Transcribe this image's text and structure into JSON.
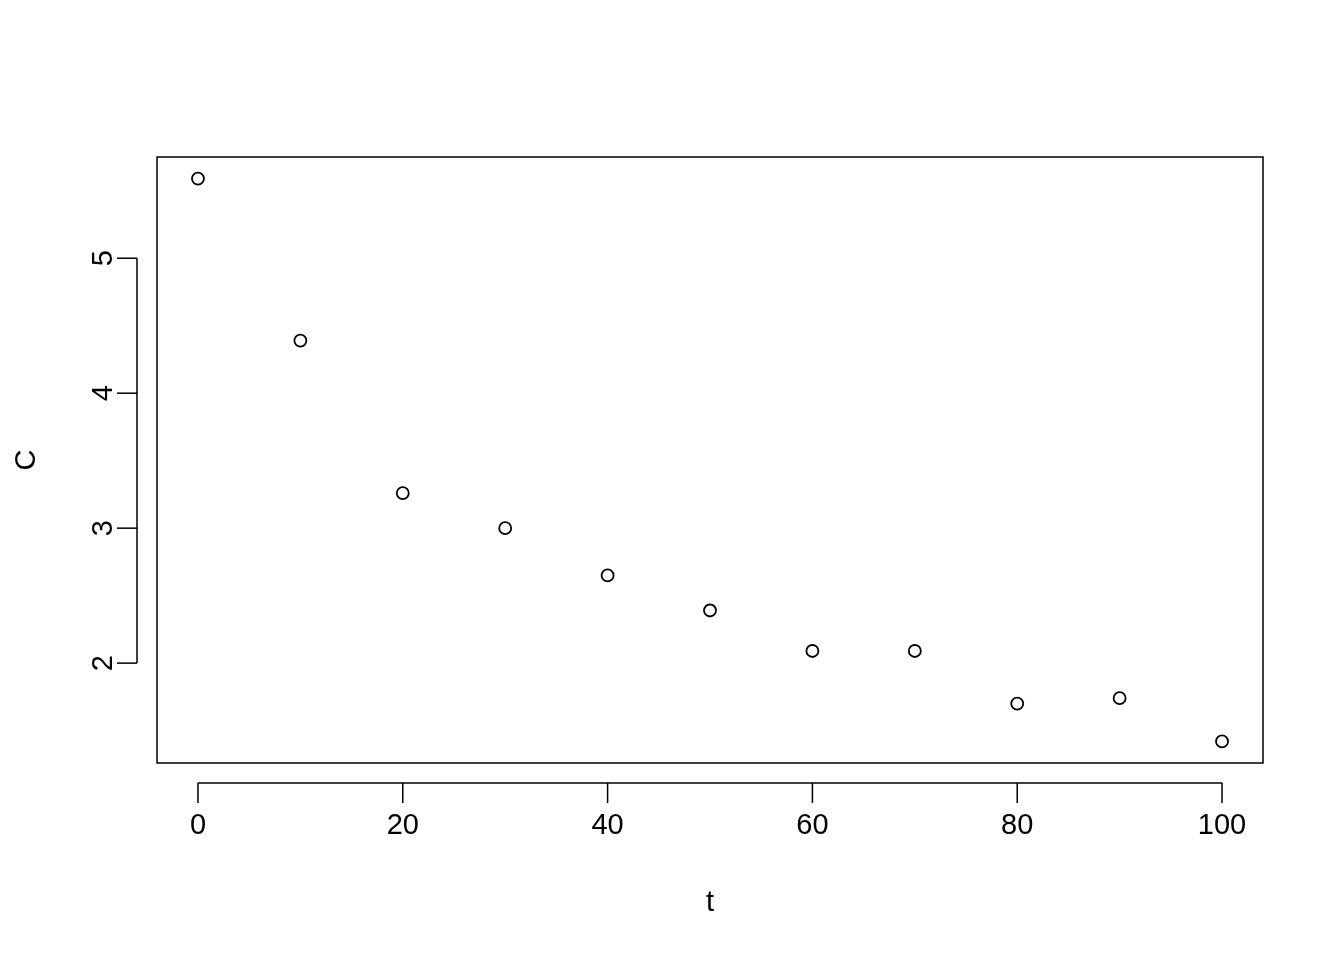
{
  "chart_data": {
    "type": "scatter",
    "xlabel": "t",
    "ylabel": "C",
    "x": [
      0,
      10,
      20,
      30,
      40,
      50,
      60,
      70,
      80,
      90,
      100
    ],
    "series": [
      {
        "color": "#000000",
        "values": [
          5.59,
          4.39,
          3.26,
          3.0,
          2.65,
          2.39,
          2.09,
          2.09,
          1.7,
          1.74,
          1.42
        ]
      }
    ],
    "xlim": [
      -4,
      104
    ],
    "ylim": [
      1.26,
      5.75
    ],
    "xticks": [
      0,
      20,
      40,
      60,
      80,
      100
    ],
    "yticks": [
      2,
      3,
      4,
      5
    ]
  }
}
